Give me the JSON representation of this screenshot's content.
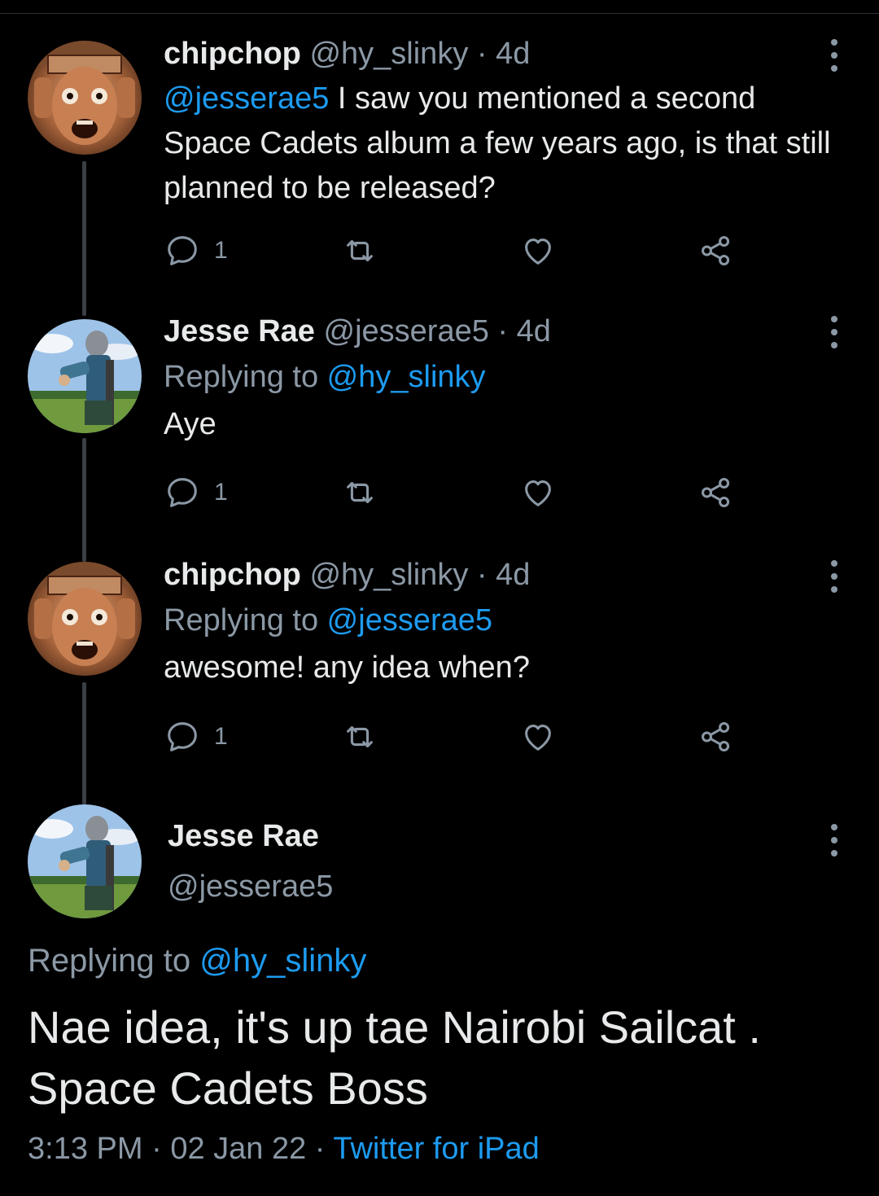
{
  "tweets": [
    {
      "name": "chipchop",
      "handle": "@hy_slinky",
      "separator": "·",
      "time": "4d",
      "mention": "@jesserae5",
      "text": " I saw you mentioned a second Space Cadets album a few years ago, is that still planned to be released?",
      "reply_count": "1",
      "avatar_icon": "screaming-face-avatar"
    },
    {
      "name": "Jesse Rae",
      "handle": "@jesserae5",
      "separator": "·",
      "time": "4d",
      "replying_label": "Replying to ",
      "replying_handle": "@hy_slinky",
      "text": "Aye",
      "reply_count": "1",
      "avatar_icon": "knight-in-field-avatar"
    },
    {
      "name": "chipchop",
      "handle": "@hy_slinky",
      "separator": "·",
      "time": "4d",
      "replying_label": "Replying to ",
      "replying_handle": "@jesserae5",
      "text": "awesome! any idea when?",
      "reply_count": "1",
      "avatar_icon": "screaming-face-avatar"
    }
  ],
  "main_tweet": {
    "name": "Jesse Rae",
    "handle": "@jesserae5",
    "replying_label": "Replying to ",
    "replying_handle": "@hy_slinky",
    "text": "Nae idea, it's up tae Nairobi Sailcat . Space Cadets Boss",
    "time": "3:13 PM",
    "sep1": "·",
    "date": "02 Jan 22",
    "sep2": "·",
    "source": "Twitter for iPad"
  },
  "colors": {
    "background": "#000000",
    "text": "#e7e9ea",
    "muted": "#8b98a5",
    "link": "#1d9bf0"
  }
}
